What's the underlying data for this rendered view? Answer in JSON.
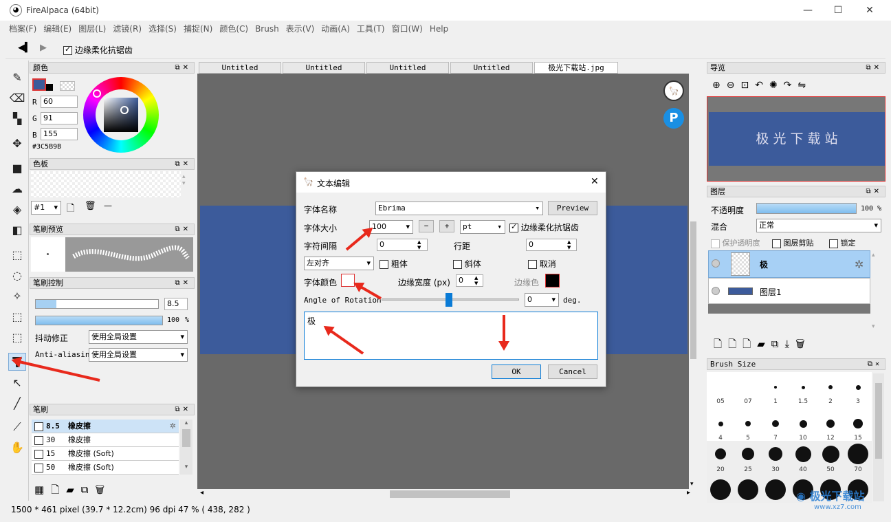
{
  "window": {
    "title": "FireAlpaca (64bit)",
    "min": "—",
    "max": "☐",
    "close": "✕"
  },
  "menu": [
    "档案(F)",
    "编辑(E)",
    "图层(L)",
    "滤镜(R)",
    "选择(S)",
    "捕捉(N)",
    "颜色(C)",
    "Brush",
    "表示(V)",
    "动画(A)",
    "工具(T)",
    "窗口(W)",
    "Help"
  ],
  "toolbar": {
    "antialias_label": "边缘柔化抗锯齿"
  },
  "color_panel": {
    "title": "颜色",
    "r_label": "R",
    "r": "60",
    "g_label": "G",
    "g": "91",
    "b_label": "B",
    "b": "155",
    "hex": "#3C5B9B"
  },
  "palette_panel": {
    "title": "色板",
    "set": "#1",
    "line": "—"
  },
  "brush_preview": {
    "title": "笔刷预览"
  },
  "brush_control": {
    "title": "笔刷控制",
    "size": "8.5",
    "opacity": "100",
    "pct": "%",
    "stabilizer_label": "抖动修正",
    "stabilizer": "使用全局设置",
    "aa_label": "Anti-aliasin",
    "aa": "使用全局设置"
  },
  "brush_list": {
    "title": "笔刷",
    "items": [
      {
        "size": "8.5",
        "name": "橡皮擦"
      },
      {
        "size": "30",
        "name": "橡皮擦"
      },
      {
        "size": "15",
        "name": "橡皮擦 (Soft)"
      },
      {
        "size": "50",
        "name": "橡皮擦 (Soft)"
      }
    ]
  },
  "tabs": [
    "Untitled",
    "Untitled",
    "Untitled",
    "Untitled",
    "极光下载站.jpg"
  ],
  "dialog": {
    "title": "文本编辑",
    "font_name_label": "字体名称",
    "font": "Ebrima",
    "preview": "Preview",
    "size_label": "字体大小",
    "size": "100",
    "minus": "−",
    "plus": "+",
    "unit": "pt",
    "aa_label": "边缘柔化抗锯齿",
    "spacing_label": "字符间隔",
    "spacing": "0",
    "line_label": "行距",
    "line": "0",
    "align": "左对齐",
    "bold": "粗体",
    "italic": "斜体",
    "cancel_style": "取消",
    "color_label": "字体颜色",
    "border_width_label": "边缘宽度 (px)",
    "border_width": "0",
    "border_color_label": "边缘色",
    "rotation_label": "Angle of Rotation",
    "rotation": "0",
    "deg": "deg.",
    "text": "极",
    "ok": "OK",
    "cancel": "Cancel"
  },
  "navigator": {
    "title": "导览",
    "preview_text": "极 光 下 载 站"
  },
  "layers": {
    "title": "图层",
    "opacity_label": "不透明度",
    "opacity": "100 %",
    "blend_label": "混合",
    "blend": "正常",
    "protect": "保护透明度",
    "clip": "图层剪贴",
    "lock": "锁定",
    "items": [
      "极",
      "图层1"
    ]
  },
  "brush_size": {
    "title": "Brush Size",
    "rows": [
      [
        "05",
        "07",
        "1",
        "1.5",
        "2",
        "3"
      ],
      [
        "4",
        "5",
        "7",
        "10",
        "12",
        "15"
      ],
      [
        "20",
        "25",
        "30",
        "40",
        "50",
        "70"
      ]
    ]
  },
  "status": {
    "text": "1500 * 461 pixel    (39.7 * 12.2cm)   96 dpi   47 %   ( 438, 282 )"
  },
  "watermark": "极光下载站",
  "watermark_url": "www.xz7.com"
}
